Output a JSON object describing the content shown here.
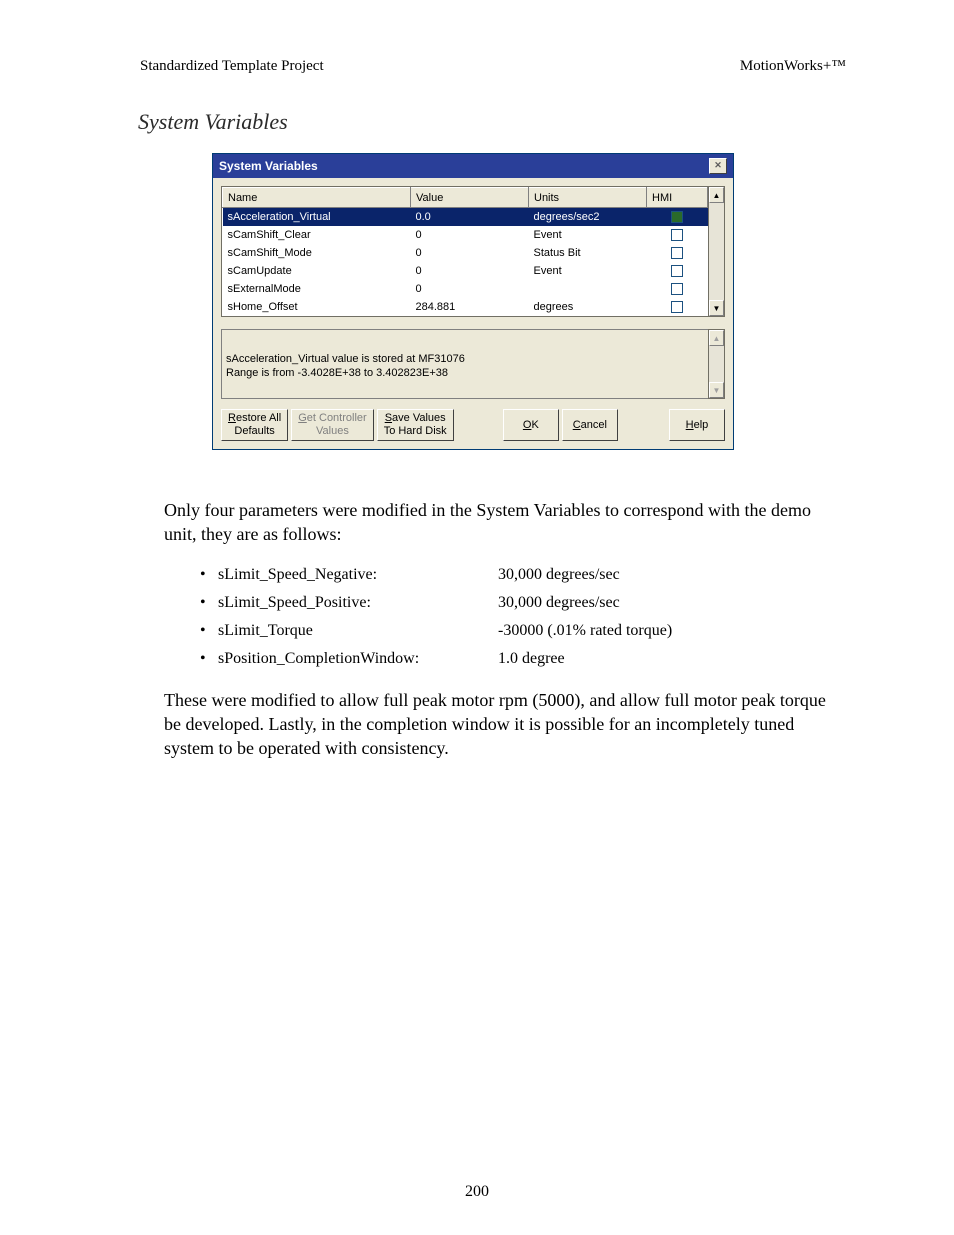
{
  "header": {
    "left": "Standardized Template Project",
    "right": "MotionWorks+™"
  },
  "section_title": "System Variables",
  "dialog": {
    "title": "System Variables",
    "columns": {
      "name": "Name",
      "value": "Value",
      "units": "Units",
      "hmi": "HMI"
    },
    "rows": [
      {
        "name": "sAcceleration_Virtual",
        "value": "0.0",
        "units": "degrees/sec2",
        "hmi": true,
        "selected": true
      },
      {
        "name": "sCamShift_Clear",
        "value": "0",
        "units": "Event",
        "hmi": false,
        "selected": false
      },
      {
        "name": "sCamShift_Mode",
        "value": "0",
        "units": "Status Bit",
        "hmi": false,
        "selected": false
      },
      {
        "name": "sCamUpdate",
        "value": "0",
        "units": "Event",
        "hmi": false,
        "selected": false
      },
      {
        "name": "sExternalMode",
        "value": "0",
        "units": "",
        "hmi": false,
        "selected": false
      },
      {
        "name": "sHome_Offset",
        "value": "284.881",
        "units": "degrees",
        "hmi": false,
        "selected": false
      }
    ],
    "info_line1": "sAcceleration_Virtual value is stored at MF31076",
    "info_line2": "Range is from -3.4028E+38 to 3.402823E+38",
    "buttons": {
      "restore": "Restore All Defaults",
      "get": "Get Controller Values",
      "save": "Save Values To Hard Disk",
      "ok": "OK",
      "cancel": "Cancel",
      "help": "Help"
    }
  },
  "para1": "Only four parameters were modified in the System Variables to correspond with the demo unit, they are as follows:",
  "params": [
    {
      "name": "sLimit_Speed_Negative:",
      "value": "30,000 degrees/sec"
    },
    {
      "name": "sLimit_Speed_Positive:",
      "value": "30,000 degrees/sec"
    },
    {
      "name": "sLimit_Torque",
      "value": "-30000 (.01% rated torque)"
    },
    {
      "name": "sPosition_CompletionWindow:",
      "value": "1.0 degree"
    }
  ],
  "para2": "These were modified to allow full peak motor rpm (5000), and allow full motor peak torque be developed.  Lastly, in the completion window it is possible for an incompletely tuned system to be operated with consistency.",
  "page_number": "200"
}
